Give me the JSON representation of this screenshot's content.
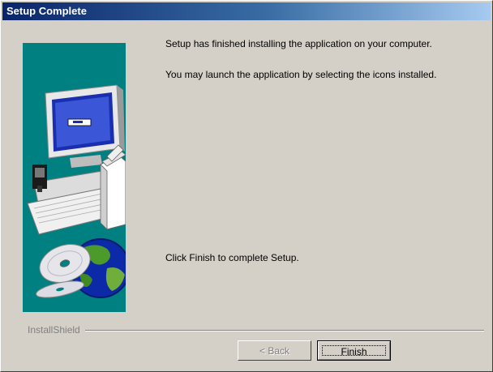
{
  "window": {
    "title": "Setup Complete"
  },
  "messages": {
    "line1": "Setup has finished installing the application on your computer.",
    "line2": "You may launch the application by selecting the icons installed.",
    "line3": "Click Finish to complete Setup."
  },
  "branding": {
    "label": "InstallShield"
  },
  "buttons": {
    "back": "< Back",
    "finish": "Finish"
  },
  "colors": {
    "title_start": "#0a246a",
    "title_end": "#a6caf0",
    "panel": "#008080",
    "face": "#d4d0c8"
  }
}
